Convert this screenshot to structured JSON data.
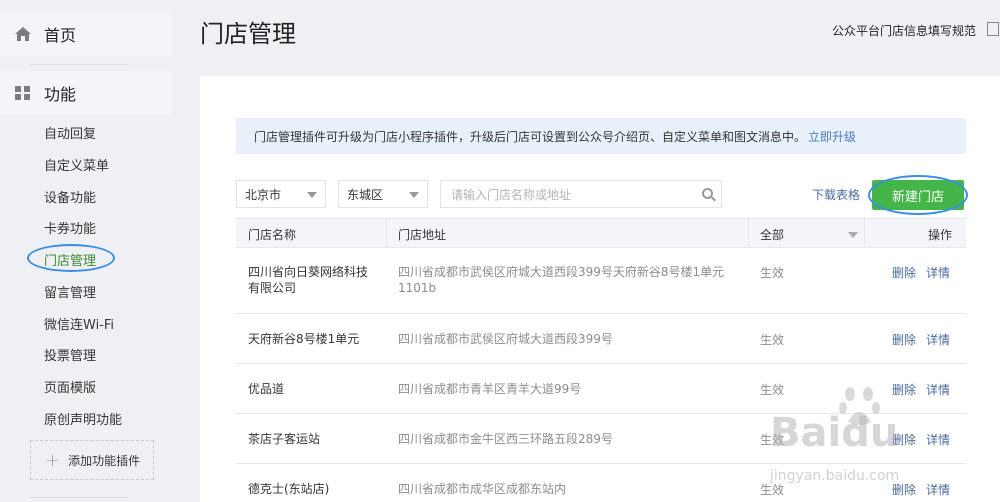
{
  "sidebar": {
    "home_label": "首页",
    "func_label": "功能",
    "items": [
      {
        "label": "自动回复"
      },
      {
        "label": "自定义菜单"
      },
      {
        "label": "设备功能"
      },
      {
        "label": "卡券功能"
      },
      {
        "label": "门店管理",
        "active": true
      },
      {
        "label": "留言管理"
      },
      {
        "label": "微信连Wi-Fi"
      },
      {
        "label": "投票管理"
      },
      {
        "label": "页面模版"
      },
      {
        "label": "原创声明功能"
      }
    ],
    "add_plugin_label": "添加功能插件",
    "accent_color": "#3d8b2f"
  },
  "header": {
    "title": "门店管理",
    "guide_link": "公众平台门店信息填写规范"
  },
  "notice": {
    "text": "门店管理插件可升级为门店小程序插件，升级后门店可设置到公众号介绍页、自定义菜单和图文消息中。",
    "upgrade_link": "立即升级"
  },
  "toolbar": {
    "city_select": "北京市",
    "district_select": "东城区",
    "search_placeholder": "请输入门店名称或地址",
    "download_label": "下载表格",
    "new_store_label": "新建门店",
    "primary_color": "#44b549"
  },
  "table": {
    "headers": {
      "name": "门店名称",
      "address": "门店地址",
      "status": "全部",
      "ops": "操作"
    },
    "rows": [
      {
        "name": "四川省向日葵网络科技有限公司",
        "address": "四川省成都市武侯区府城大道西段399号天府新谷8号楼1单元1101b",
        "status": "生效",
        "delete": "删除",
        "detail": "详情"
      },
      {
        "name": "天府新谷8号楼1单元",
        "address": "四川省成都市武侯区府城大道西段399号",
        "status": "生效",
        "delete": "删除",
        "detail": "详情"
      },
      {
        "name": "优品道",
        "address": "四川省成都市青羊区青羊大道99号",
        "status": "生效",
        "delete": "删除",
        "detail": "详情"
      },
      {
        "name": "茶店子客运站",
        "address": "四川省成都市金牛区西三环路五段289号",
        "status": "生效",
        "delete": "删除",
        "detail": "详情"
      },
      {
        "name": "德克士(东站店)",
        "address": "四川省成都市成华区成都东站内",
        "status": "生效",
        "delete": "删除",
        "detail": "详情"
      }
    ]
  },
  "watermark": {
    "brand": "Baidu",
    "sub": "jingyan.baidu.com"
  }
}
